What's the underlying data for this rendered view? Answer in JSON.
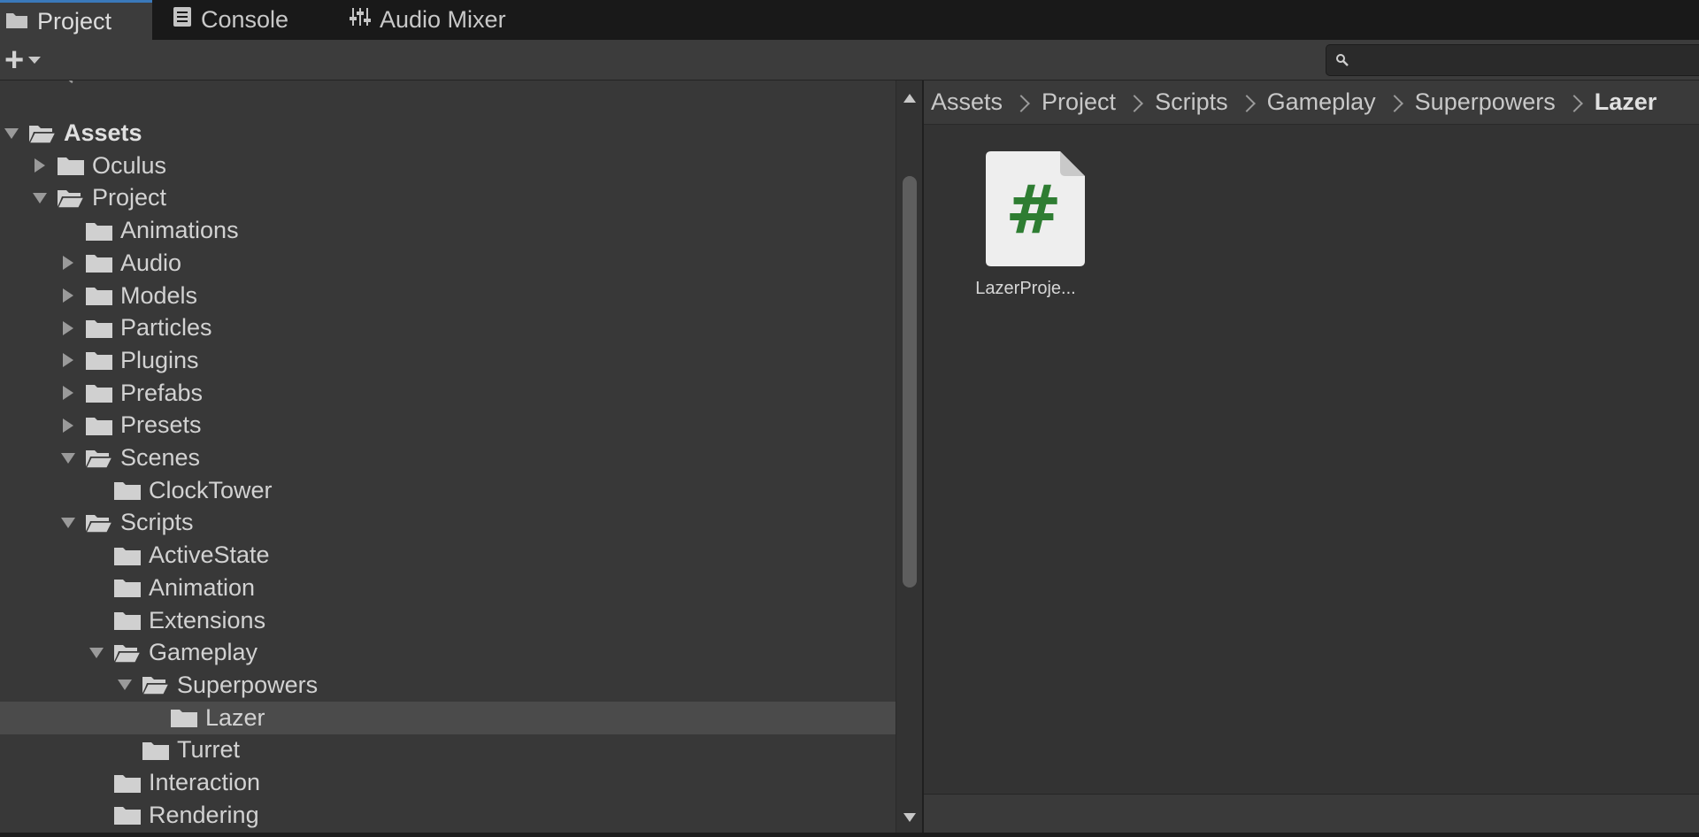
{
  "tabs": [
    {
      "label": "Project",
      "icon": "folder-icon",
      "active": true
    },
    {
      "label": "Console",
      "icon": "console-icon",
      "active": false
    },
    {
      "label": "Audio Mixer",
      "icon": "mixer-icon",
      "active": false
    }
  ],
  "toolbar": {
    "create_label": "+",
    "search": {
      "value": "",
      "placeholder": ""
    }
  },
  "tree": [
    {
      "label": "Assets",
      "depth": 0,
      "state": "expanded",
      "bold": true
    },
    {
      "label": "Oculus",
      "depth": 1,
      "state": "collapsed"
    },
    {
      "label": "Project",
      "depth": 1,
      "state": "expanded"
    },
    {
      "label": "Animations",
      "depth": 2,
      "state": "leaf"
    },
    {
      "label": "Audio",
      "depth": 2,
      "state": "collapsed"
    },
    {
      "label": "Models",
      "depth": 2,
      "state": "collapsed"
    },
    {
      "label": "Particles",
      "depth": 2,
      "state": "collapsed"
    },
    {
      "label": "Plugins",
      "depth": 2,
      "state": "collapsed"
    },
    {
      "label": "Prefabs",
      "depth": 2,
      "state": "collapsed"
    },
    {
      "label": "Presets",
      "depth": 2,
      "state": "collapsed"
    },
    {
      "label": "Scenes",
      "depth": 2,
      "state": "expanded"
    },
    {
      "label": "ClockTower",
      "depth": 3,
      "state": "leaf"
    },
    {
      "label": "Scripts",
      "depth": 2,
      "state": "expanded"
    },
    {
      "label": "ActiveState",
      "depth": 3,
      "state": "leaf"
    },
    {
      "label": "Animation",
      "depth": 3,
      "state": "leaf"
    },
    {
      "label": "Extensions",
      "depth": 3,
      "state": "leaf"
    },
    {
      "label": "Gameplay",
      "depth": 3,
      "state": "expanded"
    },
    {
      "label": "Superpowers",
      "depth": 4,
      "state": "expanded"
    },
    {
      "label": "Lazer",
      "depth": 5,
      "state": "leaf",
      "selected": true
    },
    {
      "label": "Turret",
      "depth": 4,
      "state": "leaf"
    },
    {
      "label": "Interaction",
      "depth": 3,
      "state": "leaf"
    },
    {
      "label": "Rendering",
      "depth": 3,
      "state": "leaf"
    }
  ],
  "breadcrumb": [
    "Assets",
    "Project",
    "Scripts",
    "Gameplay",
    "Superpowers",
    "Lazer"
  ],
  "assets": [
    {
      "name": "LazerProje...",
      "icon": "csharp-script-icon",
      "glyph": "#",
      "glyph_color": "#2e7d32"
    }
  ],
  "colors": {
    "tab_accent": "#3a79bb",
    "panel_bg": "#383838",
    "selected_row": "#4b4b4b",
    "content_bg": "#333333"
  }
}
